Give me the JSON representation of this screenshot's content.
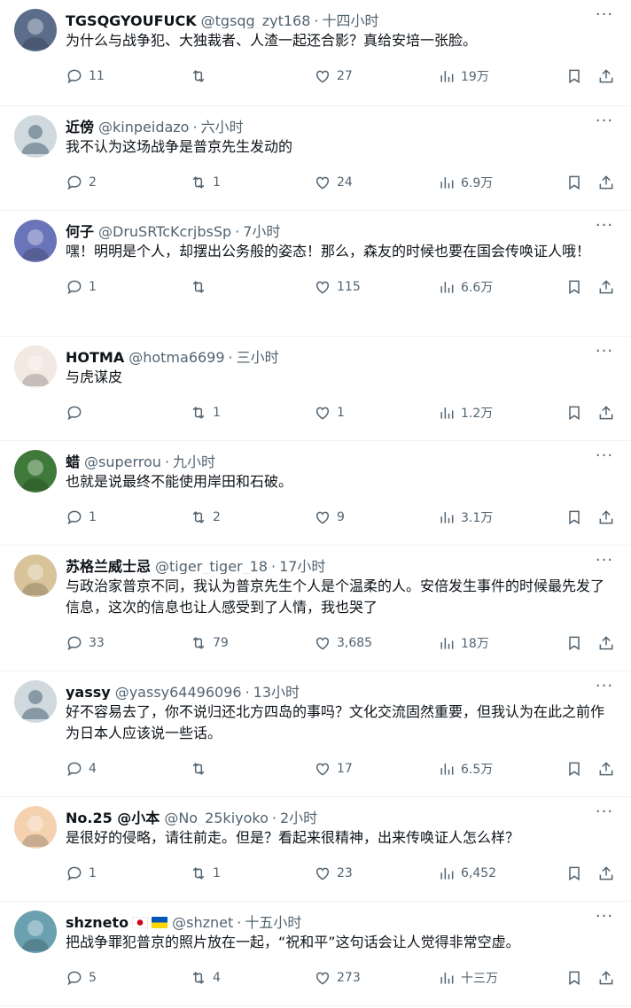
{
  "tweets": [
    {
      "name": "TGSQGYOUFUCK",
      "handle": "@tgsqg_zyt168",
      "time": "十四小时",
      "text": "为什么与战争犯、大独裁者、人渣一起还合影？真给安培一张脸。",
      "replies": "11",
      "retweets": "",
      "likes": "27",
      "views": "19万",
      "avatar_color": "#5b6d8a"
    },
    {
      "name": "近傍",
      "handle": "@kinpeidazo",
      "time": "六小时",
      "text": "我不认为这场战争是普京先生发动的",
      "replies": "2",
      "retweets": "1",
      "likes": "24",
      "views": "6.9万",
      "avatar_color": "#cfd9de"
    },
    {
      "name": "何子",
      "handle": "@DruSRTcKcrjbsSp",
      "time": "7小时",
      "text": "嘿！明明是个人，却摆出公务般的姿态！那么，森友的时候也要在国会传唤证人哦！",
      "replies": "1",
      "retweets": "",
      "likes": "115",
      "views": "6.6万",
      "avatar_color": "#6a74b8"
    },
    {
      "name": "HOTMA",
      "handle": "@hotma6699",
      "time": "三小时",
      "text": "与虎谋皮",
      "replies": "",
      "retweets": "1",
      "likes": "1",
      "views": "1.2万",
      "avatar_color": "#f3e8e2"
    },
    {
      "name": "蜡",
      "handle": "@superrou",
      "time": "九小时",
      "text": "也就是说最终不能使用岸田和石破。",
      "replies": "1",
      "retweets": "2",
      "likes": "9",
      "views": "3.1万",
      "avatar_color": "#3f7a3a"
    },
    {
      "name": "苏格兰威士忌",
      "handle": "@tiger_tiger_18",
      "time": "17小时",
      "text": "与政治家普京不同，我认为普京先生个人是个温柔的人。安倍发生事件的时候最先发了信息，这次的信息也让人感受到了人情，我也哭了",
      "replies": "33",
      "retweets": "79",
      "likes": "3,685",
      "views": "18万",
      "avatar_color": "#d8c39a"
    },
    {
      "name": "yassy",
      "handle": "@yassy64496096",
      "time": "13小时",
      "text": "好不容易去了，你不说归还北方四岛的事吗？文化交流固然重要，但我认为在此之前作为日本人应该说一些话。",
      "replies": "4",
      "retweets": "",
      "likes": "17",
      "views": "6.5万",
      "avatar_color": "#cfd9de"
    },
    {
      "name": "No.25 @小本",
      "handle": "@No_25kiyoko",
      "time": "2小时",
      "text": "是很好的侵略，请往前走。但是？看起来很精神，出来传唤证人怎么样？",
      "replies": "1",
      "retweets": "1",
      "likes": "23",
      "views": "6,452",
      "avatar_color": "#f4d2b0"
    },
    {
      "name": "shzneto",
      "handle": "@shznet",
      "time": "十五小时",
      "text": "把战争罪犯普京的照片放在一起，“祝和平”这句话会让人觉得非常空虚。",
      "replies": "5",
      "retweets": "4",
      "likes": "273",
      "views": "十三万",
      "avatar_color": "#6aa0b0"
    }
  ],
  "sep": "·",
  "more_glyph": "···",
  "icons": [
    "reply-icon",
    "retweet-icon",
    "like-icon",
    "views-icon",
    "bookmark-icon",
    "share-icon",
    "more-icon"
  ],
  "colors": {
    "secondary": "#536471",
    "primary": "#0f1419",
    "divider": "#eff3f4"
  }
}
